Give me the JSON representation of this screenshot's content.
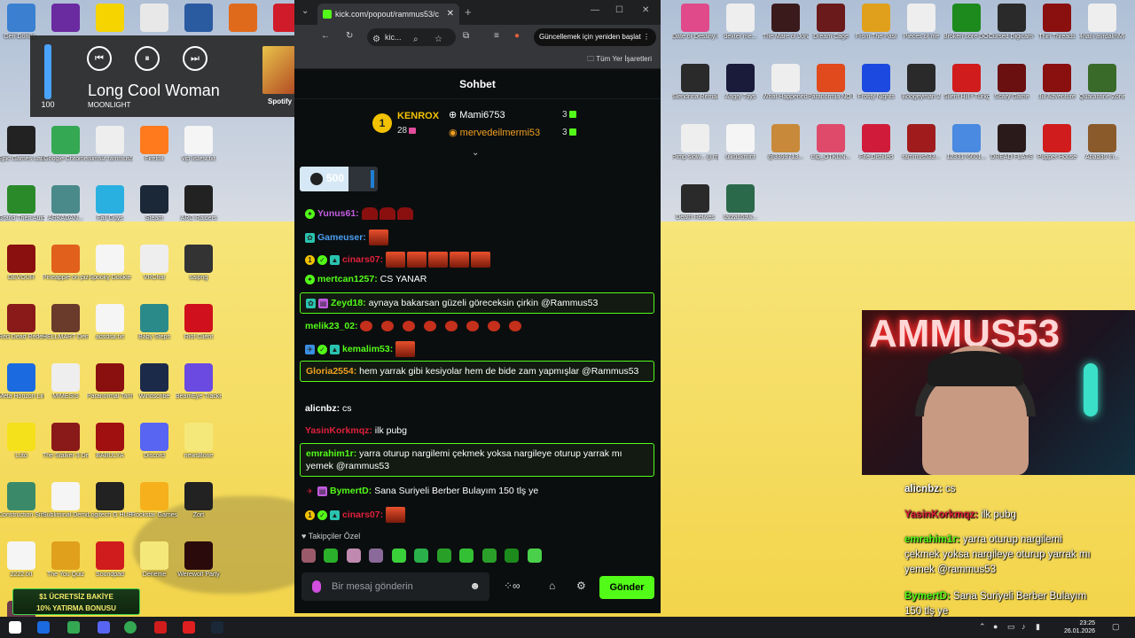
{
  "desktop": {
    "left_icons": [
      {
        "label": "Geri Dönüş..",
        "color": "#3a7fd0"
      },
      {
        "label": "",
        "color": "#6a2aa0"
      },
      {
        "label": "",
        "color": "#f5d400"
      },
      {
        "label": "",
        "color": "#e8e8e8"
      },
      {
        "label": "",
        "color": "#2a5aa0"
      },
      {
        "label": "",
        "color": "#e06a1c"
      },
      {
        "label": "",
        "color": "#d01c2a"
      },
      {
        "label": "Epic Games Launcher",
        "color": "#222222"
      },
      {
        "label": "Google Chrome",
        "color": "#34a853"
      },
      {
        "label": "İsimsiz rammus53...",
        "color": "#eeeeee"
      },
      {
        "label": "Firefox",
        "color": "#ff7a1c"
      },
      {
        "label": "vip listesi.txt",
        "color": "#f5f5f5"
      },
      {
        "label": "Grand Theft Auto V En...",
        "color": "#2a8a2a"
      },
      {
        "label": "ARKADAN...",
        "color": "#4a8a8a"
      },
      {
        "label": "Fall Guys",
        "color": "#2ab0e0"
      },
      {
        "label": "Steam",
        "color": "#1b2838"
      },
      {
        "label": "ARC Raiders",
        "color": "#222222"
      },
      {
        "label": "DEVOUR",
        "color": "#8a1010"
      },
      {
        "label": "Pineapple on pizza",
        "color": "#e0601c"
      },
      {
        "label": "Spooky Dookie",
        "color": "#f5f5f5"
      },
      {
        "label": "VRChat",
        "color": "#eeeeee"
      },
      {
        "label": "saipng",
        "color": "#333333"
      },
      {
        "label": "Red Dead Redempti...",
        "color": "#8a1a1a"
      },
      {
        "label": "HELLMART Demo",
        "color": "#6a3a2a"
      },
      {
        "label": "adsdsa.txt",
        "color": "#f5f5f5"
      },
      {
        "label": "Baby Steps",
        "color": "#2a8a8a"
      },
      {
        "label": "Riot Client",
        "color": "#d0101c"
      },
      {
        "label": "Meta Horizon Link",
        "color": "#1c6ae0"
      },
      {
        "label": "MIMESIS",
        "color": "#eeeeee"
      },
      {
        "label": "Paranormal Tarmeri",
        "color": "#8a1010"
      },
      {
        "label": "Windscribe",
        "color": "#1c2a4a"
      },
      {
        "label": "BeamEye Tracker",
        "color": "#6a4ae0"
      },
      {
        "label": "Luto",
        "color": "#f5e01c"
      },
      {
        "label": "The Stalker 3 Demo",
        "color": "#8a1a1a"
      },
      {
        "label": "BABULYA",
        "color": "#a01010"
      },
      {
        "label": "Discord",
        "color": "#5865f2"
      },
      {
        "label": "newsBone",
        "color": "#f5e87a"
      },
      {
        "label": "Construction Simulator",
        "color": "#3a8a6a"
      },
      {
        "label": "Subliminal Demo",
        "color": "#f5f5f5"
      },
      {
        "label": "Logitech G HUB",
        "color": "#222222"
      },
      {
        "label": "Rockstar Games...",
        "color": "#f5b01c"
      },
      {
        "label": "Zort",
        "color": "#222222"
      },
      {
        "label": "2222.txt",
        "color": "#f5f5f5"
      },
      {
        "label": "The You Quiz",
        "color": "#e0a01c"
      },
      {
        "label": "Soundpad",
        "color": "#d01c1c"
      },
      {
        "label": "Deneme",
        "color": "#f5e87a"
      },
      {
        "label": "Werewolf Party",
        "color": "#2a0a0a"
      },
      {
        "label": "20068825...",
        "color": "#6a3a4a"
      }
    ],
    "right_icons": [
      {
        "label": "Date or Destiny Ki...",
        "color": "#e04a8a"
      },
      {
        "label": "dexter me...",
        "color": "#eeeeee"
      },
      {
        "label": "The Mare of Jonah",
        "color": "#3a1a1a"
      },
      {
        "label": "Dream Cage",
        "color": "#6a1a1a"
      },
      {
        "label": "From The Past",
        "color": "#e0a01c"
      },
      {
        "label": "Pieces of me",
        "color": "#eeeeee"
      },
      {
        "label": "Broken Lore DON'T W...",
        "color": "#1c8a1c"
      },
      {
        "label": "Cursed Digicam - R...",
        "color": "#2a2a2a"
      },
      {
        "label": "Thin Threads",
        "color": "#8a1010"
      },
      {
        "label": "4nani avrdalmMP3",
        "color": "#eeeeee"
      },
      {
        "label": "Slendrina Remake",
        "color": "#2a2a2a"
      },
      {
        "label": "Angry Toys",
        "color": "#1a1a3a"
      },
      {
        "label": "What Happened ...",
        "color": "#eeeeee"
      },
      {
        "label": "Paranormia NO REM - PI...",
        "color": "#e04a1c"
      },
      {
        "label": "Frosty Nights",
        "color": "#1c4ae0"
      },
      {
        "label": "Boogeyman 2",
        "color": "#2a2a2a"
      },
      {
        "label": "Silent Hill f Türkçe Ya...",
        "color": "#d01c1c"
      },
      {
        "label": "Scary Game",
        "color": "#6a1010"
      },
      {
        "label": "Jill Adventure",
        "color": "#8a1010"
      },
      {
        "label": "Quarantine Zone The...",
        "color": "#3a6a2a"
      },
      {
        "label": "Pimp slow... ().mp3",
        "color": "#eeeeee"
      },
      {
        "label": "ulkü1kmint",
        "color": "#f5f5f5"
      },
      {
        "label": "@3399713...",
        "color": "#c88a3a"
      },
      {
        "label": "clip_ÖTKÜN...",
        "color": "#e04a6a"
      },
      {
        "label": "Fife Distilled",
        "color": "#d01c3a"
      },
      {
        "label": "rammus533...",
        "color": "#a01c1c"
      },
      {
        "label": "1233176601...",
        "color": "#4a8ae0"
      },
      {
        "label": "DREAD FLATS",
        "color": "#2a1a1a"
      },
      {
        "label": "Puppet House",
        "color": "#d01c1c"
      },
      {
        "label": "Abadd6 In... ",
        "color": "#8a5a2a"
      },
      {
        "label": "Death Relives",
        "color": "#2a2a2a"
      },
      {
        "label": "tarzan59w...",
        "color": "#2a6a4a"
      }
    ]
  },
  "media": {
    "volume_pct": 100,
    "volume_label": "100",
    "prev_icon": "⏮",
    "pause_icon": "⏸",
    "next_icon": "⏭",
    "song": "Long Cool Woman",
    "artist": "MOONLIGHT",
    "source": "Spotify",
    "expand_icon": "›"
  },
  "browser": {
    "tab_title": "kick.com/popout/rammus53/c",
    "tab_close": "✕",
    "new_tab": "+",
    "address": "kic...",
    "update_label": "Güncellemek için yeniden başlat",
    "bookmarks_all": "Tüm Yer İşaretleri",
    "win_min": "—",
    "win_max": "☐",
    "win_close": "✕"
  },
  "chat": {
    "title": "Sohbet",
    "leaderboard": {
      "first": {
        "name": "KENROX",
        "count": "28"
      },
      "second": {
        "name": "Mami6753",
        "count": "3"
      },
      "third": {
        "name": "mervedeilmermi53",
        "count": "3"
      },
      "rank_label": "1"
    },
    "pinned_value": "500",
    "pinned_progress": 0.62,
    "messages": [
      {
        "user": "Yunus61:",
        "color": "#c15ce0",
        "text": ""
      },
      {
        "user": "Gameuser:",
        "color": "#4a9ef0",
        "text": ""
      },
      {
        "user": "cinars07:",
        "color": "#e0203a",
        "text": ""
      },
      {
        "user": "mertcan1257:",
        "color": "#53fc18",
        "text": "CS YANAR"
      },
      {
        "user": "Zeyd18:",
        "color": "#53fc18",
        "text": "aynaya bakarsan güzeli göreceksin çirkin @Rammus53"
      },
      {
        "user": "melik23_02:",
        "color": "#53fc18",
        "text": ""
      },
      {
        "user": "kemalim53:",
        "color": "#53fc18",
        "text": ""
      },
      {
        "user": "Gloria2554:",
        "color": "#f0a020",
        "text": "hem yarrak gibi kesiyolar hem de bide zam yapmışlar @Rammus53"
      },
      {
        "user": "alicnbz:",
        "color": "#ffffff",
        "text": "cs"
      },
      {
        "user": "YasinKorkmqz:",
        "color": "#e0203a",
        "text": "ilk pubg"
      },
      {
        "user": "emrahim1r:",
        "color": "#53fc18",
        "text": "yarra oturup nargilemi çekmek yoksa nargileye oturup yarrak mı yemek @rammus53"
      },
      {
        "user": "BymertD:",
        "color": "#53fc18",
        "text": "Sana Suriyeli Berber Bulayım 150 tlş ye"
      },
      {
        "user": "cinars07:",
        "color": "#e0203a",
        "text": ""
      }
    ],
    "follow_label": "Takipçiler Özel",
    "input_placeholder": "Bir mesaj gönderin",
    "send_label": "Gönder"
  },
  "webcam": {
    "neon_text": "AMMUS53"
  },
  "overlay": [
    {
      "user": "alicnbz:",
      "color": "#ffffff",
      "text": "cs"
    },
    {
      "user": "YasinKorkmqz:",
      "color": "#e0203a",
      "text": "ilk pubg"
    },
    {
      "user": "emrahim1r:",
      "color": "#53fc18",
      "text": "yarra oturup nargilemi çekmek yoksa nargileye oturup yarrak mı yemek @rammus53"
    },
    {
      "user": "BymertD:",
      "color": "#53fc18",
      "text": "Sana Suriyeli Berber Bulayım 150 tlş ye"
    }
  ],
  "ad": {
    "line1": "$1 ÜCRETSİZ BAKİYE",
    "line2": "10% YATIRMA BONUSU"
  },
  "taskbar": {
    "time": "23:25",
    "date": "26.01.2026"
  }
}
